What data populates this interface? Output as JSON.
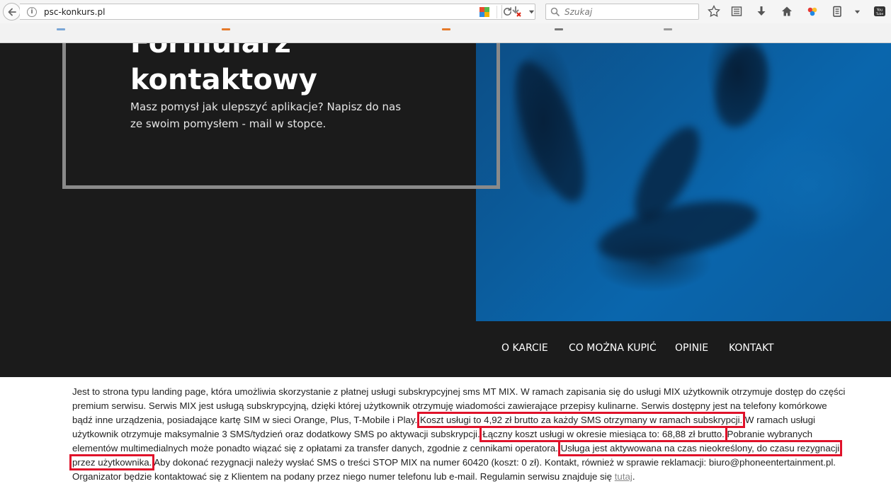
{
  "browser": {
    "url": "psc-konkurs.pl",
    "search_placeholder": "Szukaj"
  },
  "hero": {
    "title": "Formularz kontaktowy",
    "subtitle": "Masz pomysł jak ulepszyć aplikacje? Napisz do nas ze swoim pomysłem - mail w stopce."
  },
  "nav": {
    "items": [
      {
        "label": "O KARCIE"
      },
      {
        "label": "CO MOŻNA KUPIĆ"
      },
      {
        "label": "OPINIE"
      },
      {
        "label": "KONTAKT"
      }
    ]
  },
  "body": {
    "l1": "Jest to strona typu landing page, która umożliwia skorzystanie z płatnej usługi subskrypcyjnej sms MT MIX. W ramach zapisania się do usługi MIX użytkownik otrzymuje dostęp do części",
    "l2": "premium serwisu. Serwis MIX jest usługą subskrypcyjną, dzięki której użytkownik otrzymuję wiadomości zawierające przepisy kulinarne. Serwis dostępny jest na telefony komórkowe",
    "l3a": "bądź inne urządzenia, posiadające kartę SIM w sieci Orange, Plus, T-Mobile i Play. ",
    "l3b": "Koszt usługi to 4,92 zł brutto za każdy SMS otrzymany w ramach subskrypcji.",
    "l3c": " W ramach usługi",
    "l4a": "użytkownik otrzymuje maksymalnie 3 SMS/tydzień oraz dodatkowy SMS po aktywacji subskrypcji. ",
    "l4b": "Łączny koszt usługi w okresie miesiąca to: 68,88 zł brutto.",
    "l4c": " Pobranie wybranych",
    "l5a": "elementów multimedialnych może ponadto wiązać się z opłatami za transfer danych, zgodnie z cennikami operatora. ",
    "l5b": "Usługa jest aktywowana na czas nieokreślony, do czasu rezygnacji",
    "l6a": "przez użytkownika.",
    "l6b": " Aby dokonać rezygnacji należy wysłać SMS o treści STOP MIX na numer 60420 (koszt: 0 zł). Kontakt, również w sprawie reklamacji: biuro@phoneentertainment.pl.",
    "l7a": "Organizator będzie kontaktować się z Klientem na podany przez niego numer telefonu lub e-mail. Regulamin serwisu znajduje się ",
    "l7_link": "tutaj",
    "l7b": "."
  },
  "colors": {
    "highlight": "#e0122a",
    "hero_bg": "#1b1b1b",
    "photo_blue": "#0a66ad"
  }
}
